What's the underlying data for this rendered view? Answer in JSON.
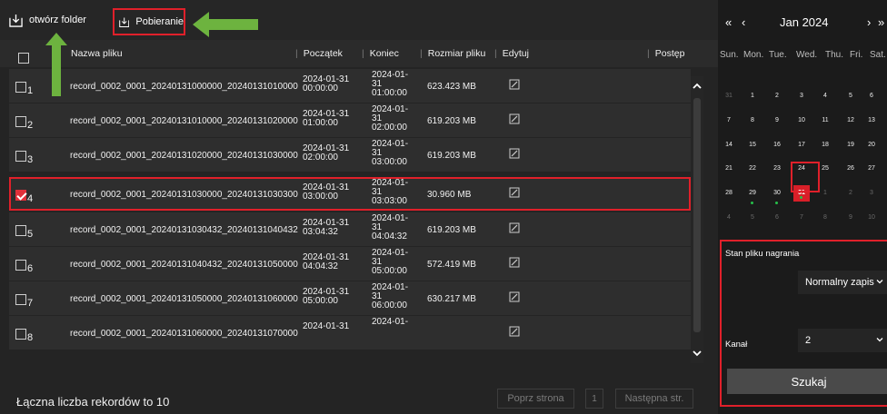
{
  "toolbar": {
    "open_folder_label": "otwórz folder",
    "download_label": "Pobieranie"
  },
  "table": {
    "headers": {
      "name": "Nazwa pliku",
      "start": "Początek",
      "end": "Koniec",
      "size": "Rozmiar pliku",
      "edit": "Edytuj",
      "progress": "Postęp"
    },
    "rows": [
      {
        "num": "1",
        "name": "record_0002_0001_20240131000000_20240131010000",
        "start": [
          "2024-01-31",
          "00:00:00"
        ],
        "end": [
          "2024-01-",
          "31",
          "01:00:00"
        ],
        "size": "623.423 MB",
        "checked": false
      },
      {
        "num": "2",
        "name": "record_0002_0001_20240131010000_20240131020000",
        "start": [
          "2024-01-31",
          "01:00:00"
        ],
        "end": [
          "2024-01-",
          "31",
          "02:00:00"
        ],
        "size": "619.203 MB",
        "checked": false
      },
      {
        "num": "3",
        "name": "record_0002_0001_20240131020000_20240131030000",
        "start": [
          "2024-01-31",
          "02:00:00"
        ],
        "end": [
          "2024-01-",
          "31",
          "03:00:00"
        ],
        "size": "619.203 MB",
        "checked": false
      },
      {
        "num": "4",
        "name": "record_0002_0001_20240131030000_20240131030300",
        "start": [
          "2024-01-31",
          "03:00:00"
        ],
        "end": [
          "2024-01-",
          "31",
          "03:03:00"
        ],
        "size": "30.960 MB",
        "checked": true
      },
      {
        "num": "5",
        "name": "record_0002_0001_20240131030432_20240131040432",
        "start": [
          "2024-01-31",
          "03:04:32"
        ],
        "end": [
          "2024-01-",
          "31",
          "04:04:32"
        ],
        "size": "619.203 MB",
        "checked": false
      },
      {
        "num": "6",
        "name": "record_0002_0001_20240131040432_20240131050000",
        "start": [
          "2024-01-31",
          "04:04:32"
        ],
        "end": [
          "2024-01-",
          "31",
          "05:00:00"
        ],
        "size": "572.419 MB",
        "checked": false
      },
      {
        "num": "7",
        "name": "record_0002_0001_20240131050000_20240131060000",
        "start": [
          "2024-01-31",
          "05:00:00"
        ],
        "end": [
          "2024-01-",
          "31",
          "06:00:00"
        ],
        "size": "630.217 MB",
        "checked": false
      },
      {
        "num": "8",
        "name": "record_0002_0001_20240131060000_20240131070000",
        "start": [
          "2024-01-31",
          ""
        ],
        "end": [
          "2024-01-",
          "",
          ""
        ],
        "size": "",
        "checked": false
      }
    ]
  },
  "footer": {
    "total_label": "Łączna liczba rekordów to 10",
    "prev_label": "Poprz strona",
    "page_num": "1",
    "next_label": "Następna str."
  },
  "calendar": {
    "prev_year": "«",
    "prev_month": "‹",
    "month_label": "Jan 2024",
    "next_month": "›",
    "next_year": "»",
    "weekdays": [
      "Sun.",
      "Mon.",
      "Tue.",
      "Wed.",
      "Thu.",
      "Fri.",
      "Sat."
    ],
    "weeks": [
      [
        {
          "d": "31",
          "m": true
        },
        {
          "d": "1"
        },
        {
          "d": "2"
        },
        {
          "d": "3"
        },
        {
          "d": "4"
        },
        {
          "d": "5"
        },
        {
          "d": "6"
        }
      ],
      [
        {
          "d": "7"
        },
        {
          "d": "8"
        },
        {
          "d": "9"
        },
        {
          "d": "10"
        },
        {
          "d": "11"
        },
        {
          "d": "12"
        },
        {
          "d": "13"
        }
      ],
      [
        {
          "d": "14"
        },
        {
          "d": "15"
        },
        {
          "d": "16"
        },
        {
          "d": "17"
        },
        {
          "d": "18"
        },
        {
          "d": "19"
        },
        {
          "d": "20"
        }
      ],
      [
        {
          "d": "21"
        },
        {
          "d": "22"
        },
        {
          "d": "23"
        },
        {
          "d": "24"
        },
        {
          "d": "25"
        },
        {
          "d": "26"
        },
        {
          "d": "27"
        }
      ],
      [
        {
          "d": "28"
        },
        {
          "d": "29",
          "rec": true
        },
        {
          "d": "30",
          "rec": true
        },
        {
          "d": "31",
          "sel": true,
          "rec": true
        },
        {
          "d": "1",
          "m": true
        },
        {
          "d": "2",
          "m": true
        },
        {
          "d": "3",
          "m": true
        }
      ],
      [
        {
          "d": "4",
          "m": true
        },
        {
          "d": "5",
          "m": true
        },
        {
          "d": "6",
          "m": true
        },
        {
          "d": "7",
          "m": true
        },
        {
          "d": "8",
          "m": true
        },
        {
          "d": "9",
          "m": true
        },
        {
          "d": "10",
          "m": true
        }
      ]
    ]
  },
  "search": {
    "record_state_label": "Stan pliku nagrania",
    "record_state_value": "Normalny zapis",
    "channel_label": "Kanał",
    "channel_value": "2",
    "search_button": "Szukaj"
  },
  "colors": {
    "highlight": "#e0202a",
    "arrow": "#6db33f",
    "record_dot": "#27c04a"
  }
}
